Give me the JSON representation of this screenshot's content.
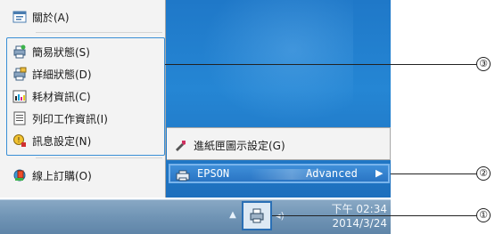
{
  "menu": {
    "items": [
      {
        "label": "關於(A)",
        "icon": "info-window-icon"
      },
      {
        "label": "簡易狀態(S)",
        "icon": "status-printer-icon"
      },
      {
        "label": "詳細狀態(D)",
        "icon": "detail-printer-icon"
      },
      {
        "label": "耗材資訊(C)",
        "icon": "ink-bars-icon"
      },
      {
        "label": "列印工作資訊(I)",
        "icon": "document-list-icon"
      },
      {
        "label": "訊息設定(N)",
        "icon": "message-settings-icon"
      },
      {
        "label": "線上訂購(O)",
        "icon": "online-order-icon"
      }
    ]
  },
  "submenu": {
    "item_label": "進紙匣圖示設定(G)",
    "icon": "tray-settings-icon"
  },
  "printer_row": {
    "brand": "EPSON",
    "mode": "Advanced",
    "arrow": "▶"
  },
  "taskbar": {
    "tray_arrow": "▲",
    "speaker_icon": "speaker-icon",
    "time": "下午 02:34",
    "date": "2014/3/24"
  },
  "callouts": {
    "one": "①",
    "two": "②",
    "three": "③"
  },
  "colors": {
    "menu_bg": "#f3f3f3",
    "highlight_blue": "#2a75c4",
    "desktop_blue": "#2586d4",
    "taskbar": "#7094b5",
    "outline_blue": "#3a8fd6"
  }
}
